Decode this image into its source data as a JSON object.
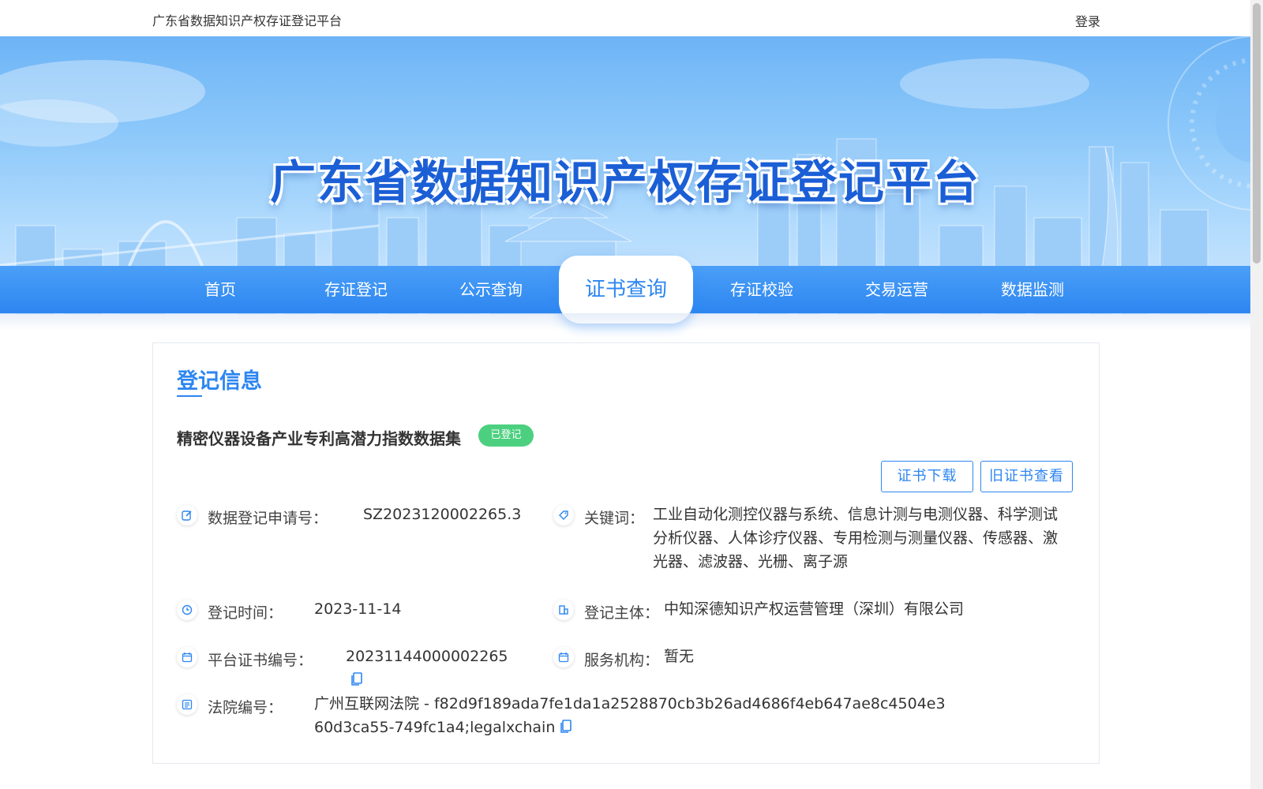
{
  "header": {
    "site_name": "广东省数据知识产权存证登记平台",
    "login_label": "登录"
  },
  "banner": {
    "title": "广东省数据知识产权存证登记平台"
  },
  "nav": {
    "items": [
      {
        "label": "首页"
      },
      {
        "label": "存证登记"
      },
      {
        "label": "公示查询"
      },
      {
        "label": "证书查询",
        "active": true
      },
      {
        "label": "存证校验"
      },
      {
        "label": "交易运营"
      },
      {
        "label": "数据监测"
      }
    ]
  },
  "card": {
    "section_title": "登记信息",
    "dataset_name": "精密仪器设备产业专利高潜力指数数据集",
    "status": "已登记",
    "buttons": {
      "download": "证书下载",
      "old_cert": "旧证书查看"
    },
    "fields": {
      "application_no": {
        "label": "数据登记申请号：",
        "value": "SZ2023120002265.3",
        "icon": "edit-icon"
      },
      "keywords": {
        "label": "关键词：",
        "value": "工业自动化测控仪器与系统、信息计测与电测仪器、科学测试分析仪器、人体诊疗仪器、专用检测与测量仪器、传感器、激光器、滤波器、光栅、离子源",
        "icon": "tag-icon"
      },
      "reg_time": {
        "label": "登记时间：",
        "value": "2023-11-14",
        "icon": "clock-icon"
      },
      "subject": {
        "label": "登记主体：",
        "value": "中知深德知识产权运营管理（深圳）有限公司",
        "icon": "org-icon"
      },
      "cert_no": {
        "label": "平台证书编号：",
        "value": "20231144000002265",
        "icon": "calendar-icon"
      },
      "service_org": {
        "label": "服务机构：",
        "value": "暂无",
        "icon": "calendar-icon"
      },
      "court_no": {
        "label": "法院编号：",
        "value_court": "广州互联网法院",
        "value_hash": " - f82d9f189ada7fe1da1a2528870cb3b26ad4686f4eb647ae8c4504e360d3ca55-749fc1a4;legalxchain",
        "icon": "list-icon"
      }
    }
  },
  "colors": {
    "primary": "#2d86f1",
    "status_green": "#4cd07f"
  }
}
